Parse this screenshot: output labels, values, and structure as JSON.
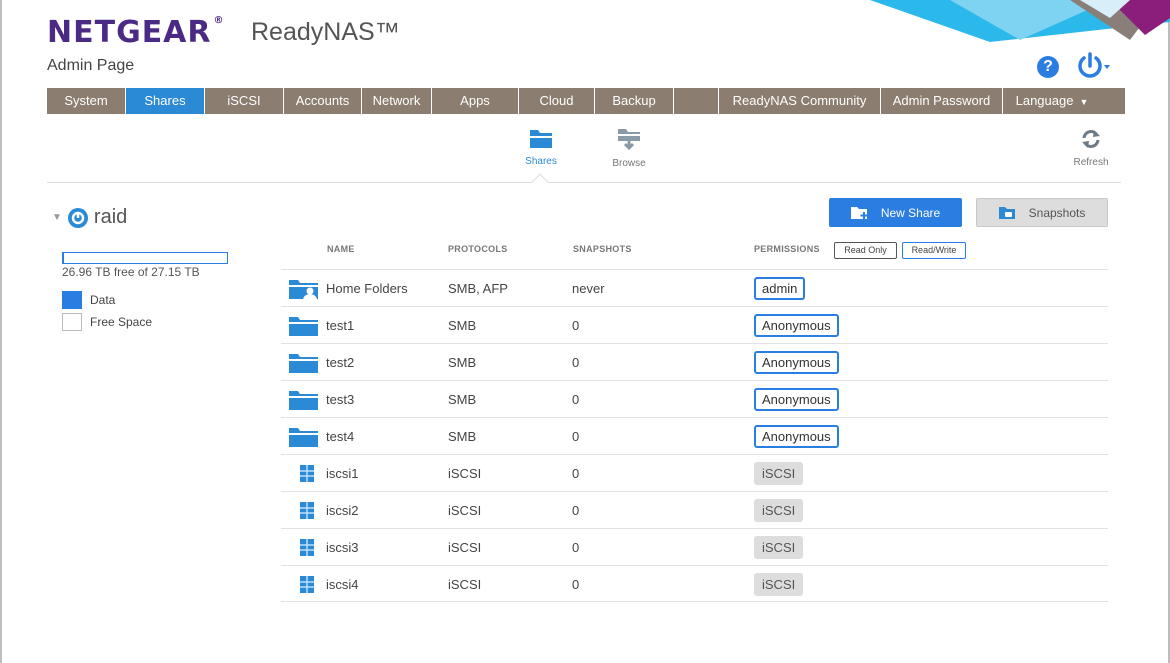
{
  "header": {
    "brand": "NETGEAR",
    "brand_mark": "®",
    "product": "ReadyNAS™",
    "page_title": "Admin Page"
  },
  "nav": {
    "items": [
      {
        "label": "System",
        "active": false
      },
      {
        "label": "Shares",
        "active": true
      },
      {
        "label": "iSCSI",
        "active": false
      },
      {
        "label": "Accounts",
        "active": false
      },
      {
        "label": "Network",
        "active": false
      },
      {
        "label": "Apps",
        "active": false
      },
      {
        "label": "Cloud",
        "active": false
      },
      {
        "label": "Backup",
        "active": false
      },
      {
        "label": "",
        "active": false
      },
      {
        "label": "ReadyNAS Community",
        "active": false
      },
      {
        "label": "Admin Password",
        "active": false
      },
      {
        "label": "Language",
        "active": false
      }
    ]
  },
  "toolbar": {
    "shares_label": "Shares",
    "browse_label": "Browse",
    "refresh_label": "Refresh"
  },
  "volume": {
    "name": "raid",
    "usage_fraction": 0.007,
    "free_text": "26.96 TB free of 27.15 TB",
    "legend_data": "Data",
    "legend_free": "Free Space"
  },
  "actions": {
    "new_share": "New Share",
    "snapshots": "Snapshots"
  },
  "table": {
    "headers": {
      "name": "NAME",
      "protocols": "PROTOCOLS",
      "snapshots": "SNAPSHOTS",
      "permissions": "PERMISSIONS"
    },
    "perm_buttons": {
      "read_only": "Read Only",
      "read_write": "Read/Write"
    },
    "rows": [
      {
        "name": "Home Folders",
        "protocols": "SMB, AFP",
        "snapshots": "never",
        "permission": "admin",
        "kind": "home"
      },
      {
        "name": "test1",
        "protocols": "SMB",
        "snapshots": "0",
        "permission": "Anonymous",
        "kind": "folder"
      },
      {
        "name": "test2",
        "protocols": "SMB",
        "snapshots": "0",
        "permission": "Anonymous",
        "kind": "folder"
      },
      {
        "name": "test3",
        "protocols": "SMB",
        "snapshots": "0",
        "permission": "Anonymous",
        "kind": "folder"
      },
      {
        "name": "test4",
        "protocols": "SMB",
        "snapshots": "0",
        "permission": "Anonymous",
        "kind": "folder"
      },
      {
        "name": "iscsi1",
        "protocols": "iSCSI",
        "snapshots": "0",
        "permission": "iSCSI",
        "kind": "lun"
      },
      {
        "name": "iscsi2",
        "protocols": "iSCSI",
        "snapshots": "0",
        "permission": "iSCSI",
        "kind": "lun"
      },
      {
        "name": "iscsi3",
        "protocols": "iSCSI",
        "snapshots": "0",
        "permission": "iSCSI",
        "kind": "lun"
      },
      {
        "name": "iscsi4",
        "protocols": "iSCSI",
        "snapshots": "0",
        "permission": "iSCSI",
        "kind": "lun"
      }
    ]
  },
  "colors": {
    "accent": "#2a7de1",
    "nav_bg": "#8b7d6f",
    "brand_purple": "#4b2a86"
  }
}
